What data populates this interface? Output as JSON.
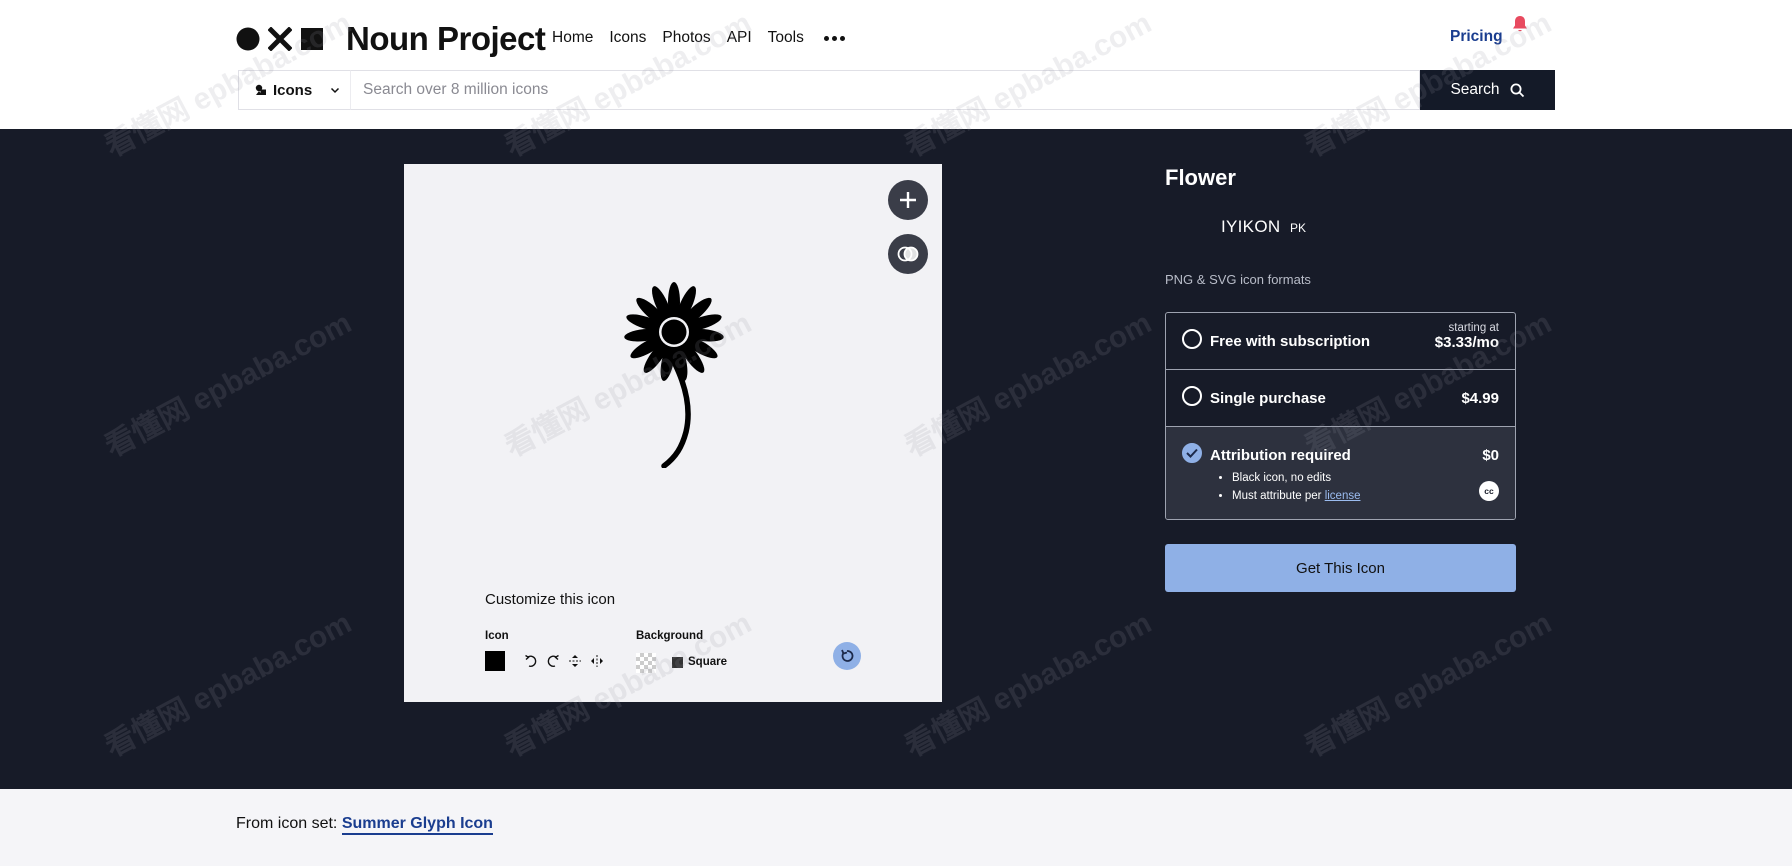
{
  "header": {
    "logo_text": "Noun Project",
    "nav": [
      "Home",
      "Icons",
      "Photos",
      "API",
      "Tools"
    ],
    "pricing_label": "Pricing"
  },
  "search": {
    "type_label": "Icons",
    "placeholder": "Search over 8 million icons",
    "button_label": "Search"
  },
  "preview": {
    "customize_title": "Customize this icon",
    "icon_label": "Icon",
    "background_label": "Background",
    "square_label": "Square",
    "icon_color": "#000000"
  },
  "details": {
    "title": "Flower",
    "creator": "IYIKON",
    "creator_country": "PK",
    "formats": "PNG & SVG icon formats",
    "options": {
      "subscription": {
        "label": "Free with subscription",
        "starting": "starting at",
        "price": "$3.33/mo",
        "selected": false
      },
      "single": {
        "label": "Single purchase",
        "price": "$4.99",
        "selected": false
      },
      "attribution": {
        "label": "Attribution required",
        "price": "$0",
        "selected": true,
        "bullet_1": "Black icon, no edits",
        "bullet_2_prefix": "Must attribute per",
        "bullet_2_link": "license",
        "badge": "cc"
      }
    },
    "cta_label": "Get This Icon"
  },
  "footer": {
    "from_set_prefix": "From icon set:",
    "from_set_link": "Summer Glyph Icon"
  },
  "watermark": {
    "line_1": "看懂网",
    "line_2": "epbaba.com"
  },
  "colors": {
    "dark_bg": "#171b28",
    "accent_blue": "#8fb0e6",
    "link_blue": "#1a3d8f",
    "bell_red": "#e84a5f"
  }
}
